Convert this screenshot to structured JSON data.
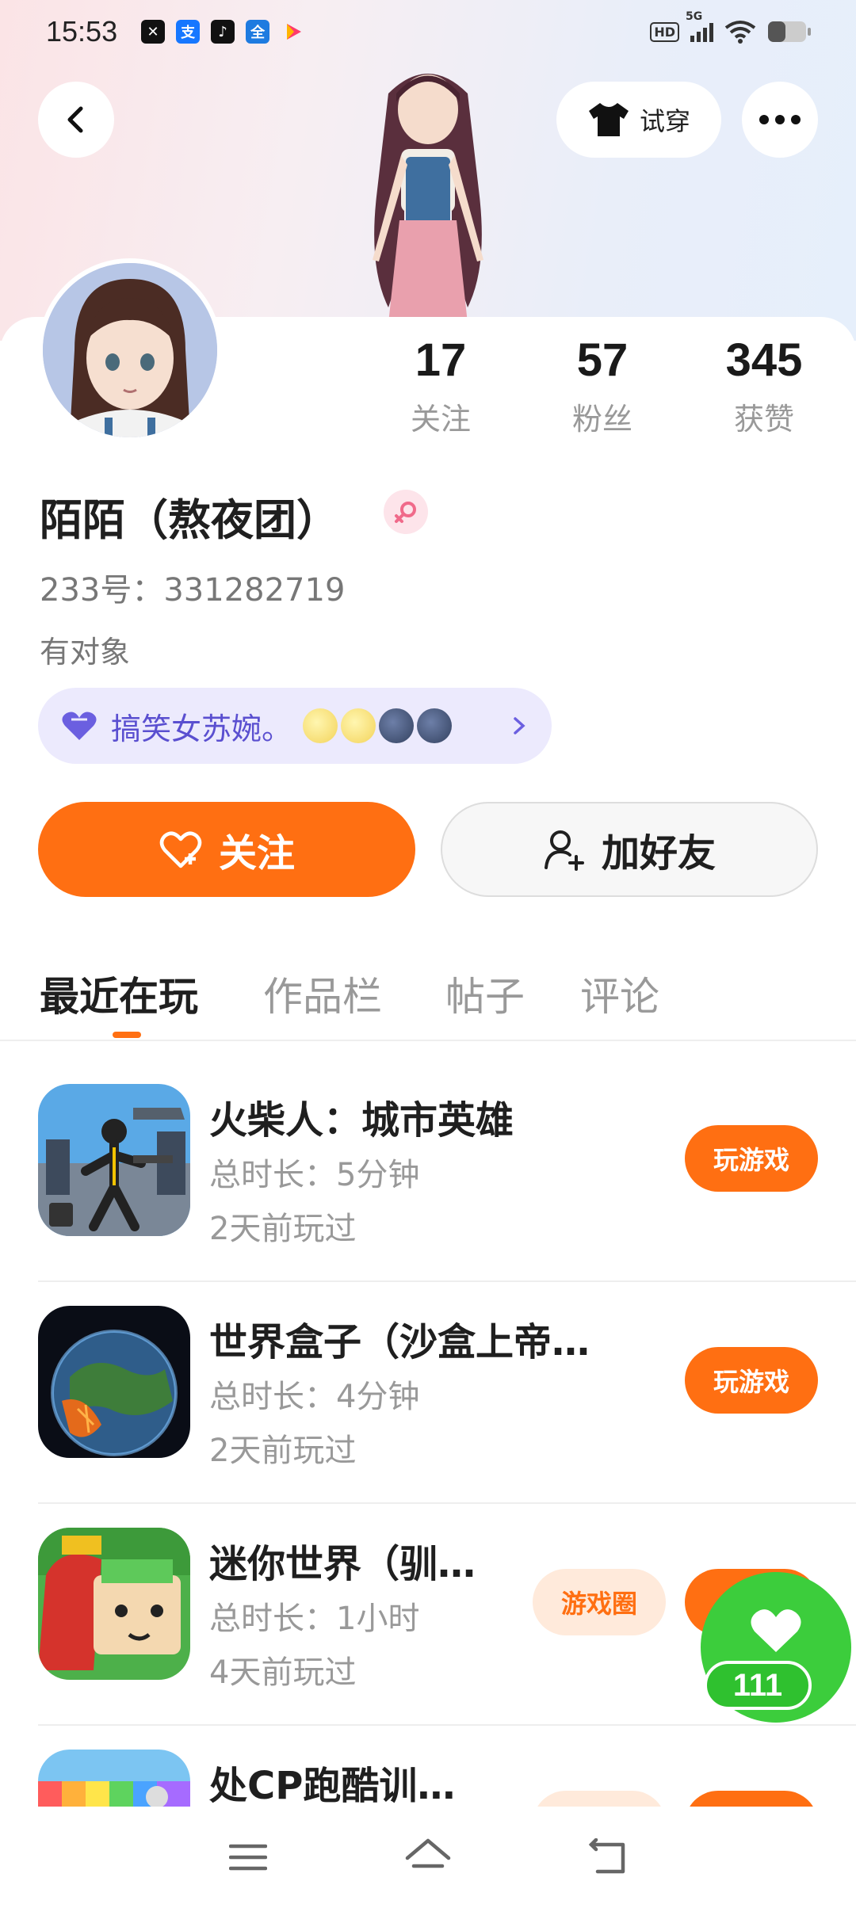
{
  "status_bar": {
    "time": "15:53",
    "apps": [
      "capcut-icon",
      "alipay-icon",
      "tiktok-icon",
      "quanmin-icon",
      "video-icon"
    ],
    "hd": "HD",
    "network": "5G"
  },
  "header": {
    "tryon_label": "试穿"
  },
  "profile": {
    "stats": [
      {
        "value": "17",
        "label": "关注"
      },
      {
        "value": "57",
        "label": "粉丝"
      },
      {
        "value": "345",
        "label": "获赞"
      }
    ],
    "name": "陌陌（熬夜团）",
    "gender_icon": "female-icon",
    "uid": "233号：331282719",
    "relationship": "有对象",
    "signature": "搞笑女苏婉。"
  },
  "actions": {
    "follow_label": "关注",
    "add_friend_label": "加好友"
  },
  "tabs": [
    {
      "label": "最近在玩",
      "active": true
    },
    {
      "label": "作品栏",
      "active": false
    },
    {
      "label": "帖子",
      "active": false
    },
    {
      "label": "评论",
      "active": false
    }
  ],
  "games": [
    {
      "title": "火柴人：城市英雄",
      "duration": "总时长：5分钟",
      "last_played": "2天前玩过",
      "play_label": "玩游戏"
    },
    {
      "title": "世界盒子（沙盒上帝…",
      "duration": "总时长：4分钟",
      "last_played": "2天前玩过",
      "play_label": "玩游戏"
    },
    {
      "title": "迷你世界（驯…",
      "duration": "总时长：1小时",
      "last_played": "4天前玩过",
      "circle_label": "游戏圈"
    },
    {
      "title": "处CP跑酷训…"
    }
  ],
  "like_bubble": {
    "count": "111"
  },
  "colors": {
    "accent": "#ff6f12",
    "like_green": "#3ccd3c",
    "signature_text": "#5a4fd0"
  }
}
